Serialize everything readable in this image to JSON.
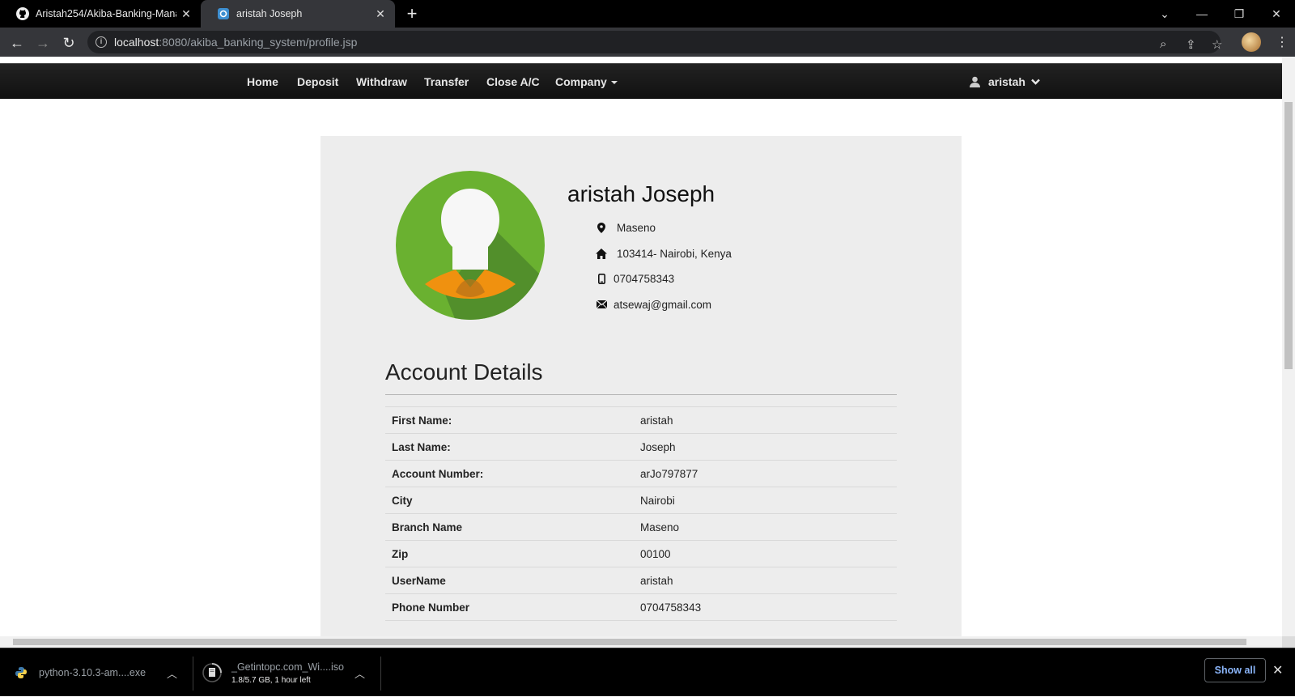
{
  "browser": {
    "tabs": [
      {
        "title": "Aristah254/Akiba-Banking-Manag",
        "icon": "github-icon"
      },
      {
        "title": "aristah Joseph",
        "icon": "site-icon"
      }
    ],
    "url": {
      "host": "localhost",
      "rest": ":8080/akiba_banking_system/profile.jsp"
    }
  },
  "navbar": {
    "links": [
      "Home",
      "Deposit",
      "Withdraw",
      "Transfer",
      "Close A/C"
    ],
    "company_label": "Company",
    "user_label": "aristah"
  },
  "profile": {
    "name": "aristah Joseph",
    "location": "Maseno",
    "address": "103414- Nairobi, Kenya",
    "phone": "0704758343",
    "email": "atsewaj@gmail.com"
  },
  "account": {
    "title": "Account Details",
    "rows": [
      {
        "label": "First Name:",
        "value": "aristah"
      },
      {
        "label": "Last Name:",
        "value": "Joseph"
      },
      {
        "label": "Account Number:",
        "value": "arJo797877"
      },
      {
        "label": "City",
        "value": "Nairobi"
      },
      {
        "label": "Branch Name",
        "value": "Maseno"
      },
      {
        "label": "Zip",
        "value": "00100"
      },
      {
        "label": "UserName",
        "value": "aristah"
      },
      {
        "label": "Phone Number",
        "value": "0704758343"
      }
    ]
  },
  "downloads": [
    {
      "name": "python-3.10.3-am....exe",
      "status": ""
    },
    {
      "name": "_Getintopc.com_Wi....iso",
      "status": "1.8/5.7 GB, 1 hour left"
    }
  ],
  "shelf": {
    "show_all": "Show all"
  },
  "colors": {
    "avatar_bg": "#6ab130",
    "avatar_collar": "#f0910f",
    "navbar_bg": "#1b1b1b",
    "panel_bg": "#ededed"
  }
}
